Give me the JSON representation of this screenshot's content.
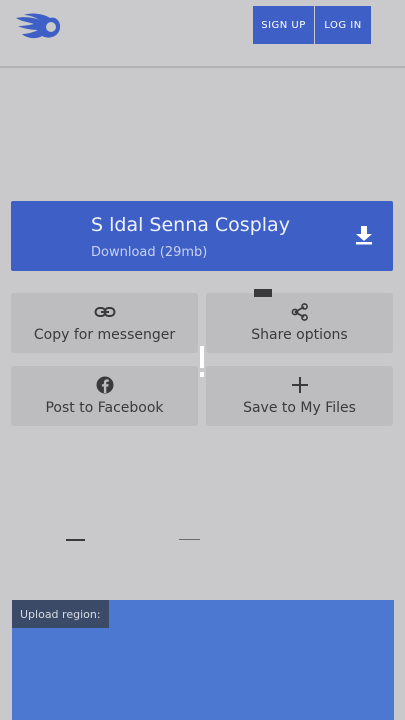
{
  "header": {
    "logo_icon": "mediafire-flame-icon",
    "signup_label": "SIGN UP",
    "login_label": "LOG IN"
  },
  "download": {
    "title": "S   ldal Senna Cosplay",
    "subtitle": "Download (29mb)",
    "icon": "download-icon"
  },
  "actions": [
    {
      "label": "Copy for messenger",
      "icon": "link-icon"
    },
    {
      "label": "Share options",
      "icon": "share-icon"
    },
    {
      "label": "Post to Facebook",
      "icon": "facebook-icon"
    },
    {
      "label": "Save to My Files",
      "icon": "plus-icon"
    }
  ],
  "upload": {
    "label": "Upload region:"
  },
  "colors": {
    "background": "#c9c9cb",
    "accent_blue": "#3d5fc6",
    "tile_gray": "#bdbdbf",
    "upload_blue": "#4c78d2"
  }
}
